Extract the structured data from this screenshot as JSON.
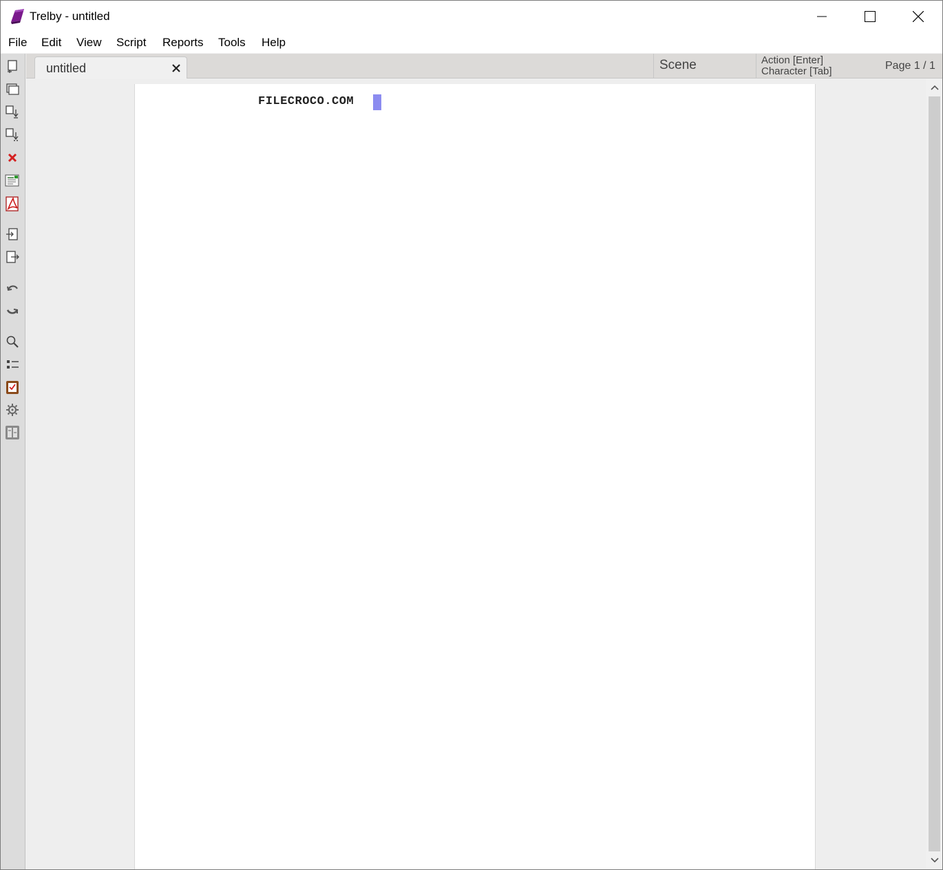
{
  "window": {
    "title": "Trelby - untitled"
  },
  "menu": {
    "items": [
      "File",
      "Edit",
      "View",
      "Script",
      "Reports",
      "Tools",
      "Help"
    ]
  },
  "toolbar": {
    "icons": [
      "new-script-icon",
      "open-icon",
      "save-icon",
      "save-as-icon",
      "close-script-icon",
      "export-icon",
      "pdf-icon",
      "import-icon",
      "export-to-icon",
      "undo-icon",
      "redo-icon",
      "find-icon",
      "outline-icon",
      "spell-check-icon",
      "settings-icon",
      "compare-icon"
    ]
  },
  "tabs": [
    {
      "label": "untitled"
    }
  ],
  "status": {
    "element_type": "Scene",
    "hint_enter": "Action [Enter]",
    "hint_tab": "Character [Tab]",
    "page": "Page 1 / 1"
  },
  "editor": {
    "line_text": "FILECROCO.COM"
  },
  "colors": {
    "accent_logo": "#7a1a8c",
    "cursor": "#8c8cf0",
    "close_icon_red": "#d42020"
  }
}
